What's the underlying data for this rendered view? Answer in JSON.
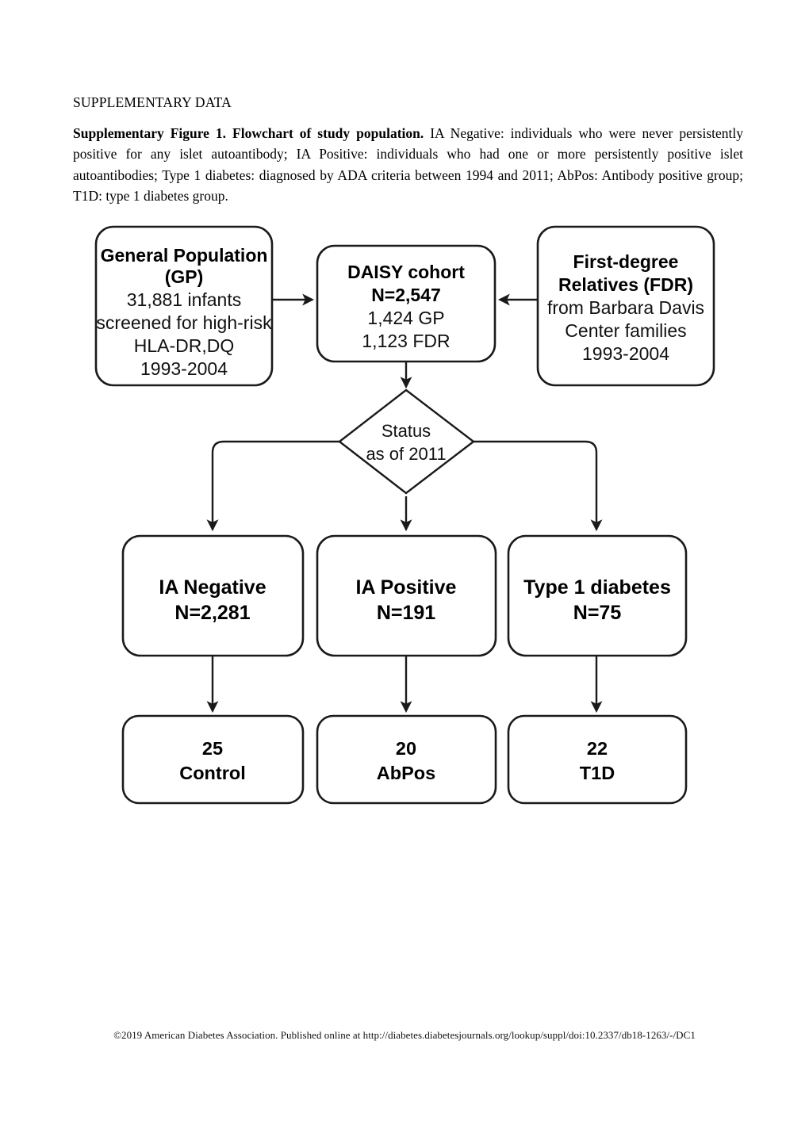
{
  "document": {
    "section_label": "SUPPLEMENTARY DATA",
    "caption_bold": "Supplementary Figure 1. Flowchart of study population.",
    "caption_rest": " IA Negative: individuals who were never persistently positive for any islet autoantibody; IA Positive: individuals who had one or more persistently positive islet autoantibodies; Type 1 diabetes: diagnosed by ADA criteria between 1994 and 2011; AbPos: Antibody positive group; T1D: type 1 diabetes group."
  },
  "footer": {
    "copyright": "©2019 American Diabetes Association. Published online at http://diabetes.diabetesjournals.org/lookup/suppl/doi:10.2337/db18-1263/-/DC1"
  },
  "chart_data": {
    "type": "diagram",
    "diagram_kind": "flowchart",
    "title": "Flowchart of study population",
    "nodes": [
      {
        "id": "gp",
        "shape": "rounded-rect",
        "lines": [
          {
            "text": "General Population",
            "style": "bold"
          },
          {
            "text": "(GP)",
            "style": "bold"
          },
          {
            "text": "31,881 infants",
            "style": "regular"
          },
          {
            "text": "screened for high-risk",
            "style": "regular"
          },
          {
            "text": "HLA-DR,DQ",
            "style": "regular"
          },
          {
            "text": "1993-2004",
            "style": "regular"
          }
        ]
      },
      {
        "id": "daisy",
        "shape": "rounded-rect",
        "lines": [
          {
            "text": "DAISY cohort",
            "style": "bold"
          },
          {
            "text": "N=2,547",
            "style": "bold"
          },
          {
            "text": "1,424 GP",
            "style": "regular"
          },
          {
            "text": "1,123 FDR",
            "style": "regular"
          }
        ]
      },
      {
        "id": "fdr",
        "shape": "rounded-rect",
        "lines": [
          {
            "text": "First-degree",
            "style": "bold"
          },
          {
            "text": "Relatives (FDR)",
            "style": "bold"
          },
          {
            "text": "from Barbara Davis",
            "style": "regular"
          },
          {
            "text": "Center families",
            "style": "regular"
          },
          {
            "text": "1993-2004",
            "style": "regular"
          }
        ]
      },
      {
        "id": "status",
        "shape": "diamond",
        "lines": [
          {
            "text": "Status",
            "style": "regular"
          },
          {
            "text": "as of 2011",
            "style": "regular"
          }
        ]
      },
      {
        "id": "ia-negative",
        "shape": "rounded-rect",
        "lines": [
          {
            "text": "IA Negative",
            "style": "bold"
          },
          {
            "text": "N=2,281",
            "style": "bold"
          }
        ]
      },
      {
        "id": "ia-positive",
        "shape": "rounded-rect",
        "lines": [
          {
            "text": "IA Positive",
            "style": "bold"
          },
          {
            "text": "N=191",
            "style": "bold"
          }
        ]
      },
      {
        "id": "type1-diabetes",
        "shape": "rounded-rect",
        "lines": [
          {
            "text": "Type 1 diabetes",
            "style": "bold"
          },
          {
            "text": "N=75",
            "style": "bold"
          }
        ]
      },
      {
        "id": "control",
        "shape": "rounded-rect",
        "lines": [
          {
            "text": "25",
            "style": "bold"
          },
          {
            "text": "Control",
            "style": "bold"
          }
        ]
      },
      {
        "id": "abpos",
        "shape": "rounded-rect",
        "lines": [
          {
            "text": "20",
            "style": "bold"
          },
          {
            "text": "AbPos",
            "style": "bold"
          }
        ]
      },
      {
        "id": "t1d",
        "shape": "rounded-rect",
        "lines": [
          {
            "text": "22",
            "style": "bold"
          },
          {
            "text": "T1D",
            "style": "bold"
          }
        ]
      }
    ],
    "edges": [
      {
        "from": "gp",
        "to": "daisy",
        "direction": "right"
      },
      {
        "from": "fdr",
        "to": "daisy",
        "direction": "left"
      },
      {
        "from": "daisy",
        "to": "status",
        "direction": "down"
      },
      {
        "from": "status",
        "to": "ia-negative",
        "direction": "down-left"
      },
      {
        "from": "status",
        "to": "ia-positive",
        "direction": "down"
      },
      {
        "from": "status",
        "to": "type1-diabetes",
        "direction": "down-right"
      },
      {
        "from": "ia-negative",
        "to": "control",
        "direction": "down"
      },
      {
        "from": "ia-positive",
        "to": "abpos",
        "direction": "down"
      },
      {
        "from": "type1-diabetes",
        "to": "t1d",
        "direction": "down"
      }
    ],
    "counts": {
      "gp_screened": 31881,
      "daisy_total": 2547,
      "daisy_gp": 1424,
      "daisy_fdr": 1123,
      "ia_negative": 2281,
      "ia_positive": 191,
      "type1_diabetes": 75,
      "control": 25,
      "abpos": 20,
      "t1d": 22
    },
    "colors": {
      "stroke": "#1a1a1a",
      "fill": "#ffffff",
      "text": "#000000"
    }
  }
}
